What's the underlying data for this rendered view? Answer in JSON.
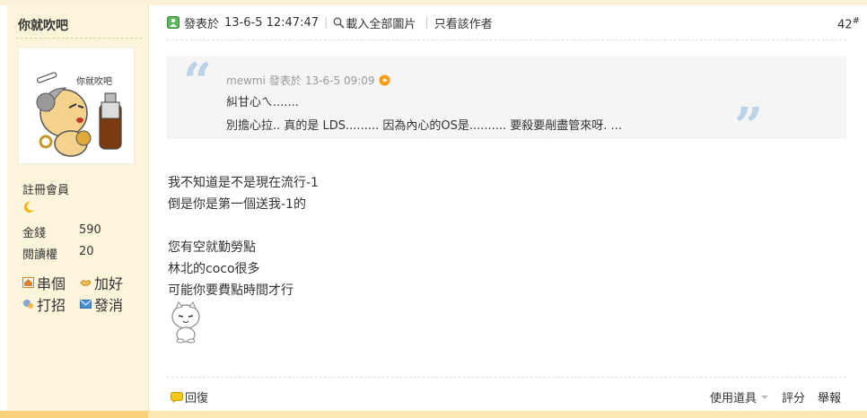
{
  "sidebar": {
    "username": "你就吹吧",
    "avatar_caption": "你就吹吧",
    "rank": "註冊會員",
    "stats": [
      {
        "label": "金錢",
        "value": "590"
      },
      {
        "label": "閱讀權",
        "value": "20"
      }
    ],
    "actions": [
      {
        "label": "串個",
        "icon": "home-icon"
      },
      {
        "label": "加好",
        "icon": "handshake-icon"
      },
      {
        "label": "打招",
        "icon": "chat-icon"
      },
      {
        "label": "發消",
        "icon": "mail-icon"
      }
    ]
  },
  "post": {
    "posted_label": "發表於",
    "posted_time": "13-6-5 12:47:47",
    "load_images": "載入全部圖片",
    "author_only": "只看該作者",
    "floor_number": "42",
    "floor_mark": "#",
    "quote": {
      "author": "mewmi",
      "posted_label": "發表於",
      "time": "13-6-5 09:09",
      "lines": [
        "糾甘心ㄟ.......",
        "別擔心拉.. 真的是 LDS......... 因為內心的OS是.......... 要殺要剮盡管來呀. ..."
      ]
    },
    "body_lines": [
      "我不知道是不是現在流行-1",
      "倒是你是第一個送我-1的",
      "您有空就勤勞點",
      "林北的coco很多",
      "可能你要費點時間才行"
    ]
  },
  "footer": {
    "reply": "回復",
    "tools": "使用道具",
    "rate": "評分",
    "report": "舉報"
  },
  "colors": {
    "sidebar_bg": "#fdf4dc",
    "quote_bg": "#f5f5f5",
    "quote_mark": "#bcd2e6",
    "accent_orange": "#f39c12"
  }
}
